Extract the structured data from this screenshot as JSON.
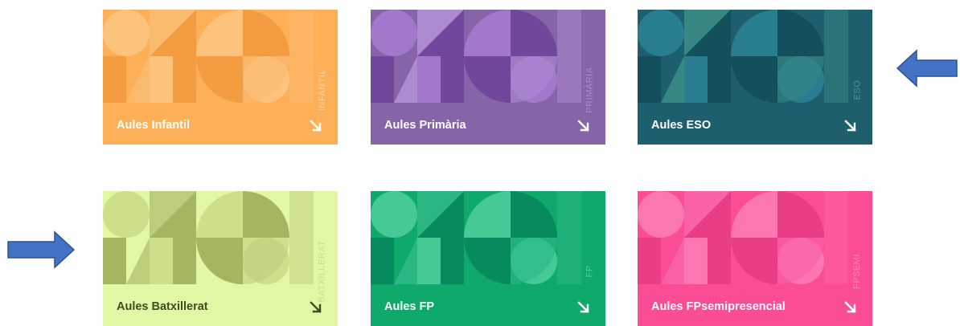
{
  "cards": [
    {
      "title": "Aules Infantil",
      "vertical_label": "INFANTIL",
      "colors": {
        "bg": "#fdb058",
        "a": "#fdc784",
        "b": "#f29a3c",
        "c": "#fbbd73",
        "text": "#ffffff",
        "vlabel": "#fbd6a6"
      }
    },
    {
      "title": "Aules Primària",
      "vertical_label": "PRIMÀRIA",
      "colors": {
        "bg": "#8564a8",
        "a": "#a77cd2",
        "b": "#6c449a",
        "c": "#b393d8",
        "text": "#ffffff",
        "vlabel": "#a98bc9"
      }
    },
    {
      "title": "Aules ESO",
      "vertical_label": "ESO",
      "colors": {
        "bg": "#1e5f6e",
        "a": "#2a8496",
        "b": "#124d5a",
        "c": "#3c8f86",
        "text": "#ffffff",
        "vlabel": "#5b8f9b"
      }
    },
    {
      "title": "Aules Batxillerat",
      "vertical_label": "BATXILLERAT",
      "colors": {
        "bg": "#e2f7a3",
        "a": "#c9dc86",
        "b": "#9aab55",
        "c": "#b5c873",
        "text": "#3f4d23",
        "vlabel": "#c9dd8c"
      }
    },
    {
      "title": "Aules FP",
      "vertical_label": "FP",
      "colors": {
        "bg": "#10a96c",
        "a": "#4fd09d",
        "b": "#06865a",
        "c": "#2fba87",
        "text": "#ffffff",
        "vlabel": "#5ccb9b"
      }
    },
    {
      "title": "Aules FPsemipresencial",
      "vertical_label": "FPSEMI",
      "colors": {
        "bg": "#fb4d96",
        "a": "#fd7eb6",
        "b": "#e63b84",
        "c": "#f966a8",
        "text": "#ffffff",
        "vlabel": "#fd8cbb"
      }
    }
  ],
  "pointers": {
    "color": "#4472c4",
    "stroke": "#2f528f"
  },
  "icons": {
    "card_arrow": "arrow-down-right-icon",
    "pointer_left": "arrow-left-icon",
    "pointer_right": "arrow-right-icon"
  }
}
